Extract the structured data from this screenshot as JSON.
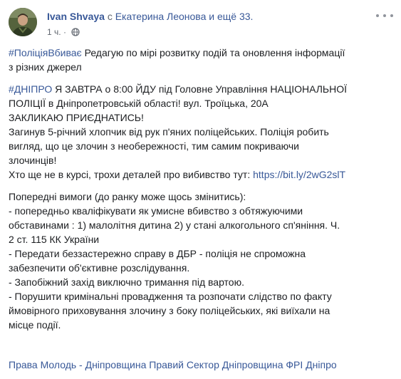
{
  "post": {
    "author": "Ivan Shvaya",
    "with_prefix": "с",
    "tagged_name": "Екатерина Леонова",
    "and_others": "и ещё 33.",
    "time": "1 ч.",
    "time_sep": "·",
    "paragraph1": {
      "hashtag": "#ПоліціяВбиває",
      "line1": "Редагую по мірі розвитку подій та оновлення інформації",
      "line2": "з різних джерел"
    },
    "paragraph2": {
      "hashtag": "#ДНІПРО",
      "line1": "Я ЗАВТРА о 8:00 ЙДУ під Головне Управління НАЦІОНАЛЬНОЇ",
      "line2": "ПОЛІЦІЇ в Дніпропетровській області! вул. Троїцька, 20А",
      "line3": "ЗАКЛИКАЮ ПРИЄДНАТИСЬ!",
      "line4": "Загинув 5-річний хлопчик від рук п'яних поліцейських. Поліція робить",
      "line5": "вигляд, що це злочин з необережності, тим самим покриваючи",
      "line6": "злочинців!",
      "line7_text": "Хто ще не в курсі, трохи деталей про вибивство тут:",
      "link": "https://bit.ly/2wG2slT"
    },
    "paragraph3": {
      "lines": [
        "Попередні вимоги (до ранку може щось змінитись):",
        "- попередньо кваліфікувати як умисне вбивство з обтяжуючими",
        "обставинами : 1) малолітня дитина 2) у стані алкогольного сп'яніння. Ч.",
        "2 ст. 115 КК України",
        "- Передати беззастережно справу в ДБР - поліція не спроможна",
        "забезпечити об'єктивне розслідування.",
        "- Запобіжний захід виключно тримання під вартою.",
        "- Порушити кримінальні провадження та розпочати слідство по факту",
        "ймовірного приховування злочину з боку поліцейських, які виїхали на",
        "місце події."
      ]
    },
    "footer_tags": "Права Молодь - Дніпровщина Правий Сектор Дніпровщина ФРІ Дніпро"
  },
  "icons": {
    "privacy": "globe-icon",
    "menu": "more-options-icon"
  },
  "colors": {
    "link": "#385898",
    "text": "#1c1e21",
    "muted": "#616770"
  }
}
